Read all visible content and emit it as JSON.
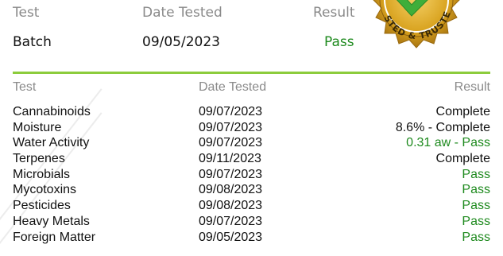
{
  "summary": {
    "headers": {
      "test": "Test",
      "date": "Date Tested",
      "result": "Result"
    },
    "row": {
      "test": "Batch",
      "date": "09/05/2023",
      "result": "Pass"
    }
  },
  "seal": {
    "text": "TESTED & TRUSTED",
    "color_gold": "#d8a21e",
    "color_check": "#3fae3a"
  },
  "divider_color": "#8ccc3c",
  "pass_color": "#1e8a1e",
  "table": {
    "headers": {
      "test": "Test",
      "date": "Date Tested",
      "result": "Result"
    },
    "rows": [
      {
        "test": "Cannabinoids",
        "date": "09/07/2023",
        "result": "Complete",
        "status": "neutral"
      },
      {
        "test": "Moisture",
        "date": "09/07/2023",
        "result": "8.6% - Complete",
        "status": "neutral"
      },
      {
        "test": "Water Activity",
        "date": "09/07/2023",
        "result": "0.31 aw - Pass",
        "status": "pass"
      },
      {
        "test": "Terpenes",
        "date": "09/11/2023",
        "result": "Complete",
        "status": "neutral"
      },
      {
        "test": "Microbials",
        "date": "09/07/2023",
        "result": "Pass",
        "status": "pass"
      },
      {
        "test": "Mycotoxins",
        "date": "09/08/2023",
        "result": "Pass",
        "status": "pass"
      },
      {
        "test": "Pesticides",
        "date": "09/08/2023",
        "result": "Pass",
        "status": "pass"
      },
      {
        "test": "Heavy Metals",
        "date": "09/07/2023",
        "result": "Pass",
        "status": "pass"
      },
      {
        "test": "Foreign Matter",
        "date": "09/05/2023",
        "result": "Pass",
        "status": "pass"
      }
    ]
  }
}
